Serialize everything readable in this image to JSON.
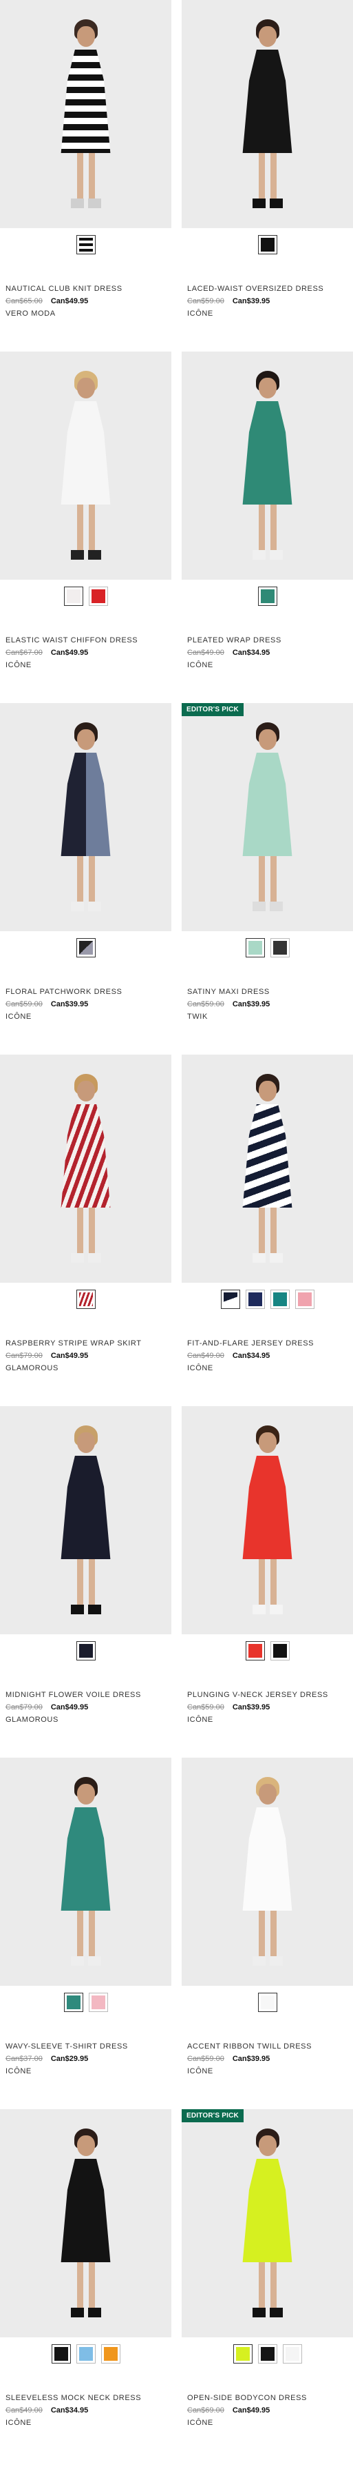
{
  "products": [
    {
      "name": "NAUTICAL CLUB KNIT DRESS",
      "old_price": "Can$65.00",
      "new_price": "Can$49.95",
      "brand": "VERO MODA",
      "badge": "",
      "dress": "repeating-linear-gradient(180deg,#111 0 9px,#fff 9px 18px)",
      "hair": "#3b2a22",
      "shoe": "#cfcfcf",
      "swatches": [
        "repeating-linear-gradient(180deg,#111 0 4px,#fff 4px 8px)"
      ]
    },
    {
      "name": "LACED-WAIST OVERSIZED DRESS",
      "old_price": "Can$59.00",
      "new_price": "Can$39.95",
      "brand": "ICÔNE",
      "badge": "",
      "dress": "#151515",
      "hair": "#2b1d18",
      "shoe": "#111111",
      "swatches": [
        "#111111"
      ]
    },
    {
      "name": "ELASTIC WAIST CHIFFON DRESS",
      "old_price": "Can$67.00",
      "new_price": "Can$49.95",
      "brand": "ICÔNE",
      "badge": "",
      "dress": "#f6f6f6",
      "hair": "#d7b47a",
      "shoe": "#222222",
      "swatches": [
        "#f2eeee",
        "#d92226"
      ]
    },
    {
      "name": "PLEATED WRAP DRESS",
      "old_price": "Can$49.00",
      "new_price": "Can$34.95",
      "brand": "ICÔNE",
      "badge": "",
      "dress": "#2f8a76",
      "hair": "#1f1714",
      "shoe": "#f0f0f0",
      "swatches": [
        "#2f8a76"
      ]
    },
    {
      "name": "FLORAL PATCHWORK DRESS",
      "old_price": "Can$59.00",
      "new_price": "Can$39.95",
      "brand": "ICÔNE",
      "badge": "",
      "dress": "linear-gradient(90deg,#1f2233 0 50%,#6e7d9b 50%)",
      "hair": "#2a1d17",
      "shoe": "#eeeeee",
      "swatches": [
        "linear-gradient(135deg,#222 0 50%,#99a 50%)"
      ]
    },
    {
      "name": "SATINY MAXI DRESS",
      "old_price": "Can$59.00",
      "new_price": "Can$39.95",
      "brand": "TWIK",
      "badge": "EDITOR'S PICK",
      "dress": "#a9d8c6",
      "hair": "#2b1d18",
      "shoe": "#dddddd",
      "swatches": [
        "#a9d8c6",
        "#333333"
      ]
    },
    {
      "name": "RASPBERRY STRIPE WRAP SKIRT",
      "old_price": "Can$79.00",
      "new_price": "Can$49.95",
      "brand": "GLAMOROUS",
      "badge": "",
      "dress": "repeating-linear-gradient(110deg,#b4232d 0 6px,#f5f0ee 6px 12px)",
      "hair": "#c79a5e",
      "shoe": "#eeeeee",
      "swatches": [
        "repeating-linear-gradient(110deg,#b4232d 0 3px,#fff 3px 6px)"
      ]
    },
    {
      "name": "FIT-AND-FLARE JERSEY DRESS",
      "old_price": "Can$49.00",
      "new_price": "Can$34.95",
      "brand": "ICÔNE",
      "badge": "",
      "dress": "repeating-linear-gradient(160deg,#141c33 0 10px,#ffffff 10px 20px)",
      "hair": "#2c1e18",
      "shoe": "#f2f2f2",
      "swatches": [
        "linear-gradient(160deg,#141c33 0 50%,#fff 50%)",
        "#1f2b5c",
        "#178583",
        "#f0a3ae"
      ]
    },
    {
      "name": "MIDNIGHT FLOWER VOILE DRESS",
      "old_price": "Can$79.00",
      "new_price": "Can$49.95",
      "brand": "GLAMOROUS",
      "badge": "",
      "dress": "#1a1c2c",
      "hair": "#c7a06a",
      "shoe": "#111111",
      "swatches": [
        "#1a1c2c"
      ]
    },
    {
      "name": "PLUNGING V-NECK JERSEY DRESS",
      "old_price": "Can$59.00",
      "new_price": "Can$39.95",
      "brand": "ICÔNE",
      "badge": "",
      "dress": "#e8342c",
      "hair": "#3a2416",
      "shoe": "#f4f4f4",
      "swatches": [
        "#e8342c",
        "#111111"
      ]
    },
    {
      "name": "WAVY-SLEEVE T-SHIRT DRESS",
      "old_price": "Can$37.00",
      "new_price": "Can$29.95",
      "brand": "ICÔNE",
      "badge": "",
      "dress": "#2f8a7d",
      "hair": "#2a1d17",
      "shoe": "#eeeeee",
      "swatches": [
        "#2f8a7d",
        "#f3b8c2"
      ]
    },
    {
      "name": "ACCENT RIBBON TWILL DRESS",
      "old_price": "Can$59.00",
      "new_price": "Can$39.95",
      "brand": "ICÔNE",
      "badge": "",
      "dress": "#fbfbfb",
      "hair": "#d9b47c",
      "shoe": "#eeeeee",
      "swatches": [
        "#f7f7f7"
      ]
    },
    {
      "name": "SLEEVELESS MOCK NECK DRESS",
      "old_price": "Can$49.00",
      "new_price": "Can$34.95",
      "brand": "ICÔNE",
      "badge": "",
      "dress": "#131313",
      "hair": "#2b1d18",
      "shoe": "#111111",
      "swatches": [
        "#131313",
        "#7fbde6",
        "#f0961c"
      ]
    },
    {
      "name": "OPEN-SIDE BODYCON DRESS",
      "old_price": "Can$69.00",
      "new_price": "Can$49.95",
      "brand": "ICÔNE",
      "badge": "EDITOR'S PICK",
      "dress": "#d6f020",
      "hair": "#2b1d18",
      "shoe": "#111111",
      "swatches": [
        "#d6f020",
        "#151515",
        "#f5f5f5"
      ]
    }
  ]
}
